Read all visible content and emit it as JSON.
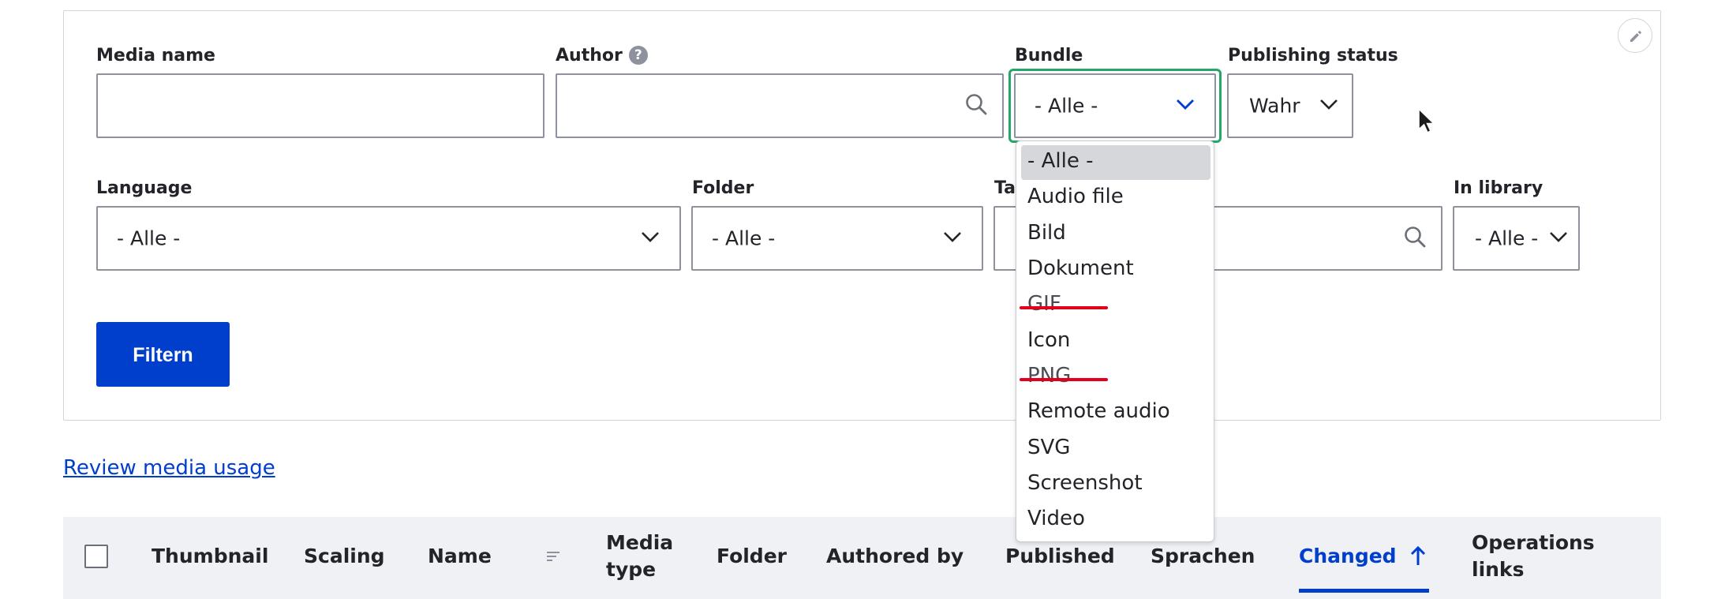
{
  "filters": {
    "media_name": {
      "label": "Media name",
      "value": ""
    },
    "author": {
      "label": "Author",
      "help": "?",
      "value": ""
    },
    "bundle": {
      "label": "Bundle",
      "selected": "- Alle -"
    },
    "publishing_status": {
      "label": "Publishing status",
      "selected": "Wahr"
    },
    "language": {
      "label": "Language",
      "selected": "- Alle -"
    },
    "folder": {
      "label": "Folder",
      "selected": "- Alle -"
    },
    "tags": {
      "label": "Ta",
      "value": ""
    },
    "in_library": {
      "label": "In library",
      "selected": "- Alle -"
    },
    "submit_label": "Filtern"
  },
  "bundle_options": [
    {
      "label": "- Alle -",
      "selected": true,
      "struck": false
    },
    {
      "label": "Audio file",
      "selected": false,
      "struck": false
    },
    {
      "label": "Bild",
      "selected": false,
      "struck": false
    },
    {
      "label": "Dokument",
      "selected": false,
      "struck": false
    },
    {
      "label": "GIF",
      "selected": false,
      "struck": true
    },
    {
      "label": "Icon",
      "selected": false,
      "struck": false
    },
    {
      "label": "PNG",
      "selected": false,
      "struck": true
    },
    {
      "label": "Remote audio",
      "selected": false,
      "struck": false
    },
    {
      "label": "SVG",
      "selected": false,
      "struck": false
    },
    {
      "label": "Screenshot",
      "selected": false,
      "struck": false
    },
    {
      "label": "Video",
      "selected": false,
      "struck": false
    }
  ],
  "review_link": "Review media usage",
  "table": {
    "columns": {
      "thumbnail": "Thumbnail",
      "scaling": "Scaling",
      "name": "Name",
      "media_type_1": "Media",
      "media_type_2": "type",
      "folder": "Folder",
      "authored_by": "Authored by",
      "published": "Published",
      "sprachen": "Sprachen",
      "changed": "Changed",
      "operations_1": "Operations",
      "operations_2": "links"
    }
  },
  "colors": {
    "primary": "#003ecc",
    "focus": "#26a769",
    "strike": "#e3001b",
    "header_bg": "#eff1f5"
  },
  "icons": {
    "edit": "pencil-icon",
    "search": "search-icon",
    "chevron": "chevron-down-icon",
    "sort": "sort-icon",
    "sort_active": "arrow-up-icon",
    "cursor": "mouse-pointer-icon"
  }
}
